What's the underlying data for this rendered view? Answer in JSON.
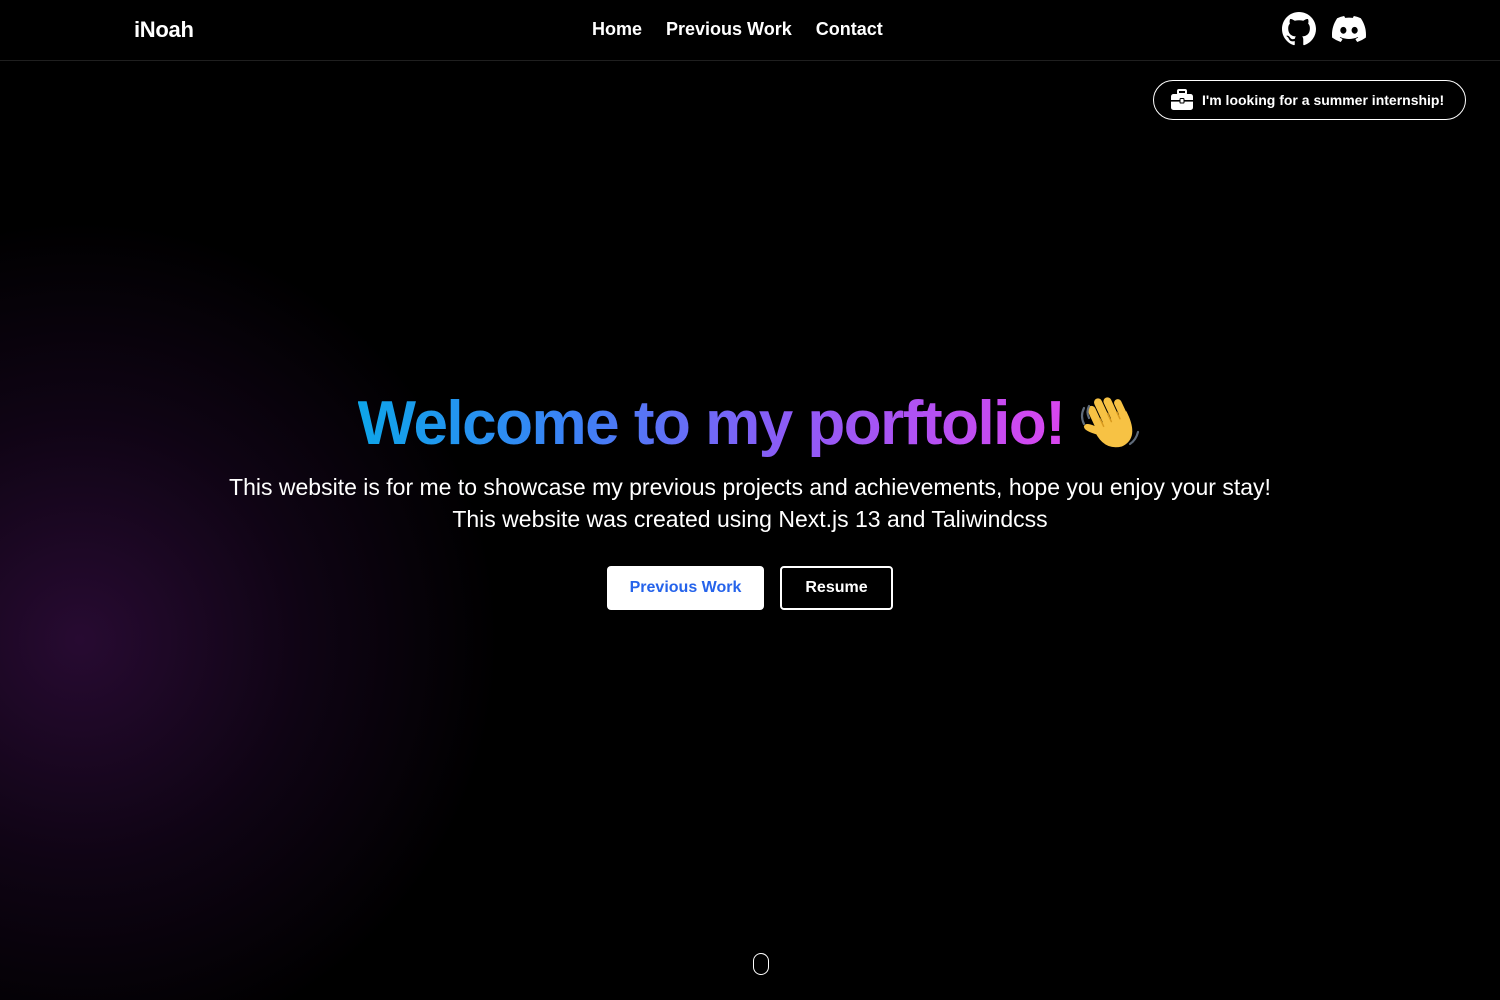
{
  "navbar": {
    "brand": "iNoah",
    "links": [
      {
        "label": "Home"
      },
      {
        "label": "Previous Work"
      },
      {
        "label": "Contact"
      }
    ],
    "social": [
      {
        "icon": "github-icon"
      },
      {
        "icon": "discord-icon"
      }
    ]
  },
  "banner": {
    "icon": "briefcase-icon",
    "text": "I'm looking for a summer internship!"
  },
  "hero": {
    "title": "Welcome to my porftolio!",
    "title_emoji": "waving-hand-icon",
    "subtitle_line1": "This website is for me to showcase my previous projects and achievements, hope you enjoy your stay!",
    "subtitle_line2": "This website was created using Next.js 13 and Taliwindcss",
    "primary_button": "Previous Work",
    "secondary_button": "Resume"
  },
  "colors": {
    "background": "#000000",
    "text": "#ffffff",
    "gradient_start": "#0ea5e9",
    "gradient_mid": "#8b5cf6",
    "gradient_end": "#d946ef",
    "primary_button_text": "#2563eb",
    "glow": "#2e0c3a"
  }
}
